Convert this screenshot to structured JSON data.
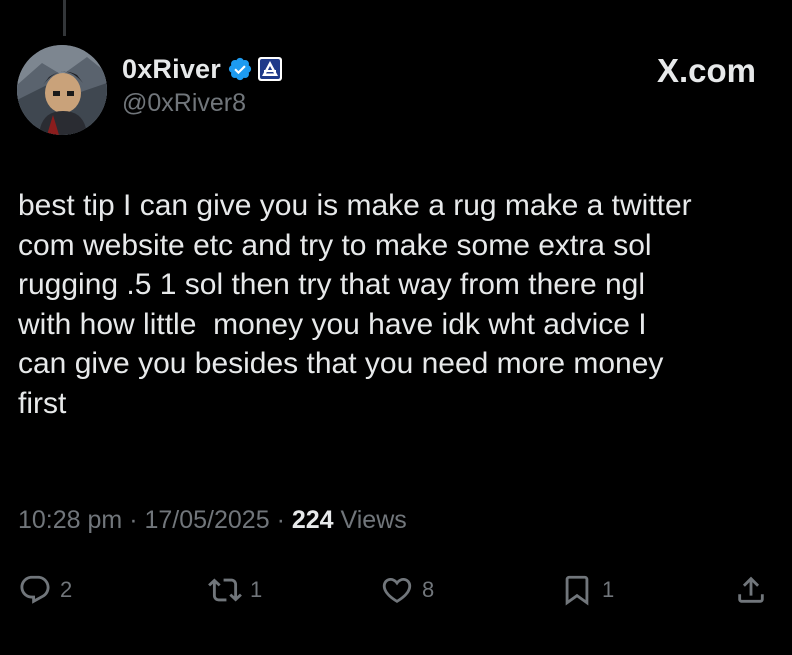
{
  "tweet": {
    "display_name": "0xRiver",
    "handle": "@0xRiver8",
    "site_label": "X.com",
    "text": "best tip I can give you is make a rug make a twitter\ncom website etc and try to make some extra sol\nrugging .5 1 sol then try that way from there ngl\nwith how little  money you have idk wht advice I\ncan give you besides that you need more money\nfirst",
    "time": "10:28 pm",
    "separator": "·",
    "date": "17/05/2025",
    "views_count": "224",
    "views_label": "Views"
  },
  "actions": {
    "reply_count": "2",
    "retweet_count": "1",
    "like_count": "8",
    "bookmark_count": "1"
  },
  "icons": {
    "verified": "verified-badge-icon",
    "affiliate": "affiliate-logo-icon",
    "reply": "reply-icon",
    "retweet": "retweet-icon",
    "like": "heart-icon",
    "bookmark": "bookmark-icon",
    "share": "share-icon"
  },
  "colors": {
    "background": "#000000",
    "primary_text": "#e7e9ea",
    "secondary_text": "#71767b",
    "verified_blue": "#1d9bf0"
  }
}
